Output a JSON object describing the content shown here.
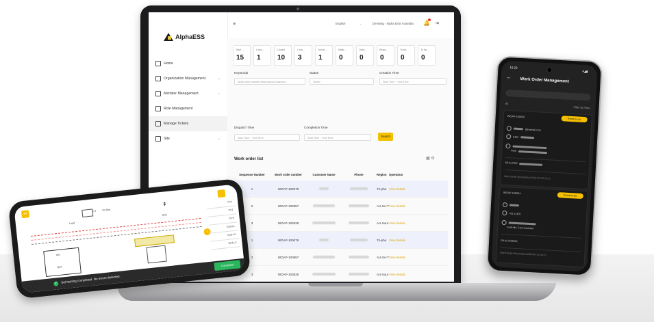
{
  "app": {
    "brand": "AlphaESS",
    "sidebar": [
      {
        "label": "Home",
        "caret": ""
      },
      {
        "label": "Organization Management",
        "caret": "⌄"
      },
      {
        "label": "Member Management",
        "caret": "⌄"
      },
      {
        "label": "Role Management",
        "caret": ""
      },
      {
        "label": "Manage Tickets",
        "caret": ""
      },
      {
        "label": "Site",
        "caret": "⌄"
      }
    ],
    "header": {
      "menu_icon": "≡",
      "language": "English",
      "user": "Devising - Alpha ESS Australia",
      "bell_icon": "🔔",
      "logout_icon": "⇥"
    },
    "stats": [
      {
        "label": "Total ...",
        "value": "15"
      },
      {
        "label": "Canc...",
        "value": "1"
      },
      {
        "label": "Closed",
        "value": "10"
      },
      {
        "label": "Com...",
        "value": "3"
      },
      {
        "label": "Servic...",
        "value": "1"
      },
      {
        "label": "Waiti...",
        "value": "0"
      },
      {
        "label": "Orde...",
        "value": "0"
      },
      {
        "label": "Read...",
        "value": "0"
      },
      {
        "label": "To be...",
        "value": "0"
      },
      {
        "label": "To be...",
        "value": "0"
      }
    ],
    "filters": {
      "keywords_label": "Keywords",
      "keywords_placeholder": "Work order number/Description/Customer...",
      "status_label": "Status",
      "status_placeholder": "Select",
      "creation_label": "Creation Time",
      "dispatch_label": "Dispatch Time",
      "completion_label": "Completion Time",
      "start": "Start Time",
      "end": "End Time",
      "date_sep": "~",
      "calendar_icon": "▯",
      "search_button": "Search"
    },
    "list": {
      "title": "Work order list",
      "tools": "▦ ⚙",
      "columns": [
        "Sequence Number",
        "Work order number",
        "Customer Name",
        "Phone",
        "Region",
        "Operation"
      ],
      "rows": [
        {
          "seq": "1",
          "number": "WOAP-100079",
          "region": "Tri-pha",
          "op": "View details"
        },
        {
          "seq": "2",
          "number": "WOAP-100557",
          "region": "AU-SA-T",
          "op": "View details"
        },
        {
          "seq": "3",
          "number": "WOAP-100528",
          "region": "AU-Sout",
          "op": "View details"
        },
        {
          "seq": "1",
          "number": "WOAP-100079",
          "region": "Tri-pha",
          "op": "View details"
        },
        {
          "seq": "2",
          "number": "WOAP-100557",
          "region": "AU-SA-T",
          "op": "View details"
        },
        {
          "seq": "3",
          "number": "WOAP-100528",
          "region": "AU-Sout",
          "op": "View details"
        }
      ]
    }
  },
  "phone_left": {
    "back_icon": "↩",
    "load_label": "Load",
    "grid_label": "Grid",
    "bat_label": "BAT",
    "inv_label": "INV",
    "ct_label": "CT",
    "pv_label": "PV Box",
    "panel": [
      "PV1",
      "PV2",
      "PV3",
      "Grid-L1",
      "Grid-L2",
      "Grid-L3"
    ],
    "status_message": "Self testing completed. No errors detected.",
    "completed": "Completed",
    "check_icon": "✓",
    "next_icon": "‹"
  },
  "phone_right": {
    "time": "15:23",
    "signal": "▾◢▮",
    "back_icon": "←",
    "title": "Work Order Management",
    "tab_all": "All",
    "filter": "Filter by Time",
    "cards": [
      {
        "order": "WOAP-100026",
        "pill": "Ready to go",
        "email_suffix": "@hotmail.com",
        "phone_prefix": "0455",
        "address": "Park,",
        "sn": "SN:AL7002",
        "received": "Work Order Received at  2024-07-23 10:17"
      },
      {
        "order": "WOAP-100024",
        "pill": "Ready to go",
        "email_suffix": "",
        "phone_prefix": "+61 41455",
        "address": "Australia, 5114,Australia",
        "sn": "SN:AL7019022",
        "received": "Work Order Received at  2024-07-23 10:17"
      }
    ]
  }
}
